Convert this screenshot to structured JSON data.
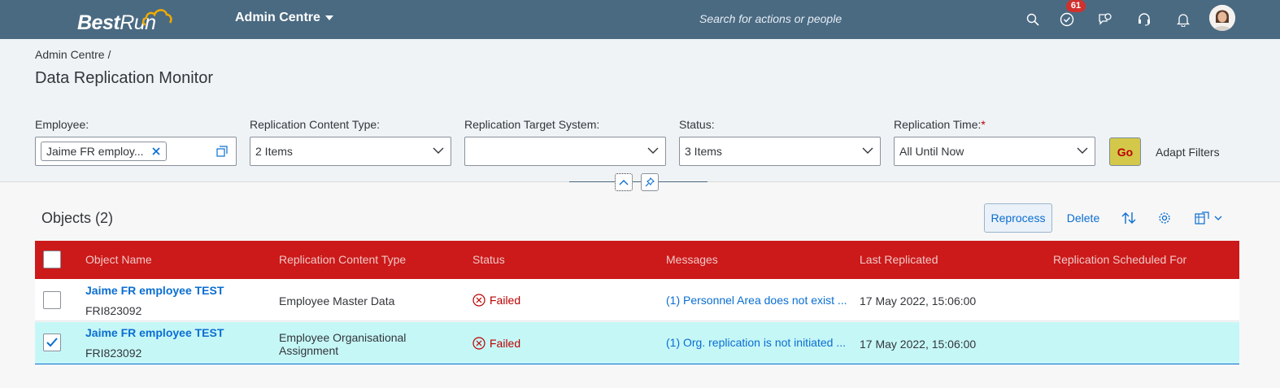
{
  "shell": {
    "logo_bold": "Best",
    "logo_light": "Run",
    "app_title": "Admin Centre",
    "search_placeholder": "Search for actions or people",
    "tasks_badge": "61",
    "colors": {
      "bar": "#4a6a82"
    }
  },
  "page": {
    "breadcrumb": "Admin Centre /",
    "title": "Data Replication Monitor"
  },
  "filters": {
    "employee_label": "Employee:",
    "employee_token": "Jaime FR employ...",
    "content_type_label": "Replication Content Type:",
    "content_type_value": "2 Items",
    "target_label": "Replication Target System:",
    "target_value": "",
    "status_label": "Status:",
    "status_value": "3 Items",
    "time_label": "Replication Time:",
    "time_required": "*",
    "time_value": "All Until Now",
    "go": "Go",
    "adapt": "Adapt Filters"
  },
  "table": {
    "title": "Objects (2)",
    "reprocess": "Reprocess",
    "delete": "Delete",
    "columns": [
      "Object Name",
      "Replication Content Type",
      "Status",
      "Messages",
      "Last Replicated",
      "Replication Scheduled For"
    ],
    "rows": [
      {
        "name": "Jaime FR employee TEST",
        "id": "FRI823092",
        "content_type": "Employee Master Data",
        "status": "Failed",
        "message": "(1) Personnel Area does not exist ...",
        "last_replicated": "17 May 2022, 15:06:00",
        "scheduled": "",
        "selected": false
      },
      {
        "name": "Jaime FR employee TEST",
        "id": "FRI823092",
        "content_type_line1": "Employee Organisational",
        "content_type_line2": "Assignment",
        "status": "Failed",
        "message": "(1) Org. replication is not initiated ...",
        "last_replicated": "17 May 2022, 15:06:00",
        "scheduled": "",
        "selected": true
      }
    ],
    "colors": {
      "header_bg": "#cc1919",
      "selected_row": "#c6f7f7",
      "link": "#0a6ed1",
      "error": "#bb0000"
    }
  }
}
